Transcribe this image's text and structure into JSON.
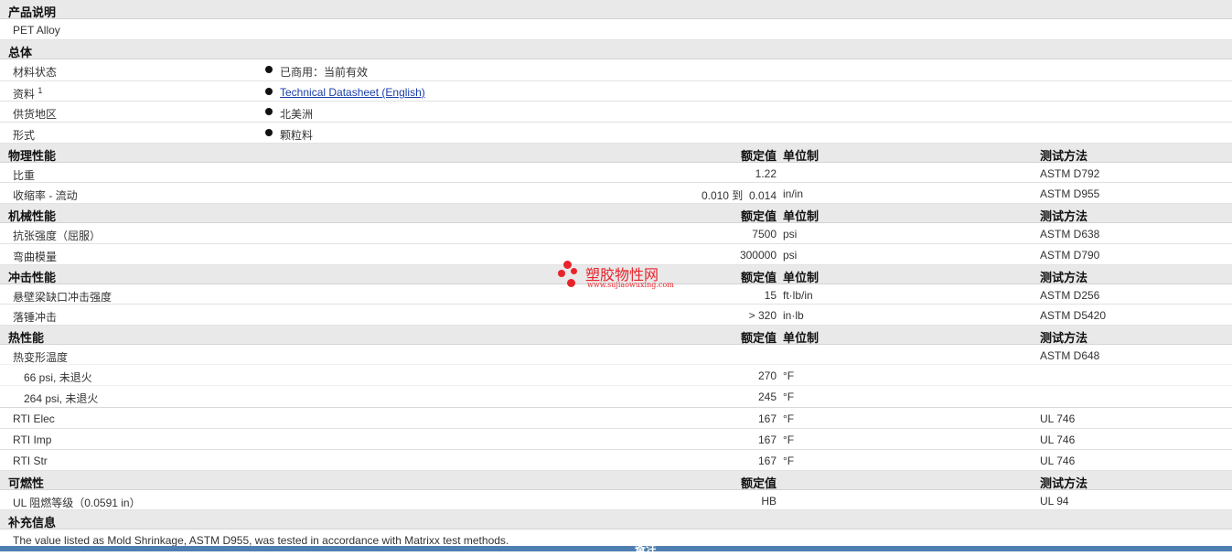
{
  "sections": {
    "description": {
      "title": "产品说明",
      "text": "PET Alloy"
    },
    "general": {
      "title": "总体",
      "rows": [
        {
          "label": "材料状态",
          "value": "已商用：当前有效"
        },
        {
          "label": "资料",
          "sup": "1",
          "value": "Technical Datasheet (English)"
        },
        {
          "label": "供货地区",
          "value": "北美洲"
        },
        {
          "label": "形式",
          "value": "颗粒料"
        }
      ]
    },
    "physical": {
      "title": "物理性能",
      "nominal": "额定值",
      "unit": "单位制",
      "test": "测试方法",
      "rows": [
        {
          "label": "比重",
          "value": "1.22",
          "unit": "",
          "test": "ASTM D792"
        },
        {
          "label": "收缩率 - 流动",
          "value": "0.010 到  0.014",
          "unit": "in/in",
          "test": "ASTM D955"
        }
      ]
    },
    "mechanical": {
      "title": "机械性能",
      "nominal": "额定值",
      "unit": "单位制",
      "test": "测试方法",
      "rows": [
        {
          "label": "抗张强度（屈服）",
          "value": "7500",
          "unit": "psi",
          "test": "ASTM D638"
        },
        {
          "label": "弯曲模量",
          "value": "300000",
          "unit": "psi",
          "test": "ASTM D790"
        }
      ]
    },
    "impact": {
      "title": "冲击性能",
      "nominal": "额定值",
      "unit": "单位制",
      "test": "测试方法",
      "rows": [
        {
          "label": "悬壁梁缺口冲击强度",
          "value": "15",
          "unit": "ft·lb/in",
          "test": "ASTM D256"
        },
        {
          "label": "落锤冲击",
          "value": "> 320",
          "unit": "in·lb",
          "test": "ASTM D5420"
        }
      ]
    },
    "thermal": {
      "title": "热性能",
      "nominal": "额定值",
      "unit": "单位制",
      "test": "测试方法",
      "hdt": {
        "label": "热变形温度",
        "test": "ASTM D648"
      },
      "sub_rows": [
        {
          "label": "66 psi, 未退火",
          "value": "270",
          "unit": "°F"
        },
        {
          "label": "264 psi, 未退火",
          "value": "245",
          "unit": "°F"
        }
      ],
      "rows": [
        {
          "label": "RTI Elec",
          "value": "167",
          "unit": "°F",
          "test": "UL 746"
        },
        {
          "label": "RTI Imp",
          "value": "167",
          "unit": "°F",
          "test": "UL 746"
        },
        {
          "label": "RTI Str",
          "value": "167",
          "unit": "°F",
          "test": "UL 746"
        }
      ]
    },
    "flammability": {
      "title": "可燃性",
      "nominal": "额定值",
      "test": "测试方法",
      "rows": [
        {
          "label": "UL 阻燃等级（0.0591 in）",
          "value": "HB",
          "test": "UL 94"
        }
      ]
    },
    "supplement": {
      "title": "补充信息",
      "text": "The value listed as Mold Shrinkage, ASTM D955, was tested in accordance with Matrixx test methods."
    }
  },
  "footer": {
    "label": "备注"
  },
  "watermark": {
    "text": "塑胶物性网",
    "url": "www.sujiaowuxing.com",
    "color": "#e8232b"
  },
  "colors": {
    "header_bg": "#e9e9e9",
    "link": "#1a3ea8",
    "footer_bar": "#4f7fb0"
  }
}
